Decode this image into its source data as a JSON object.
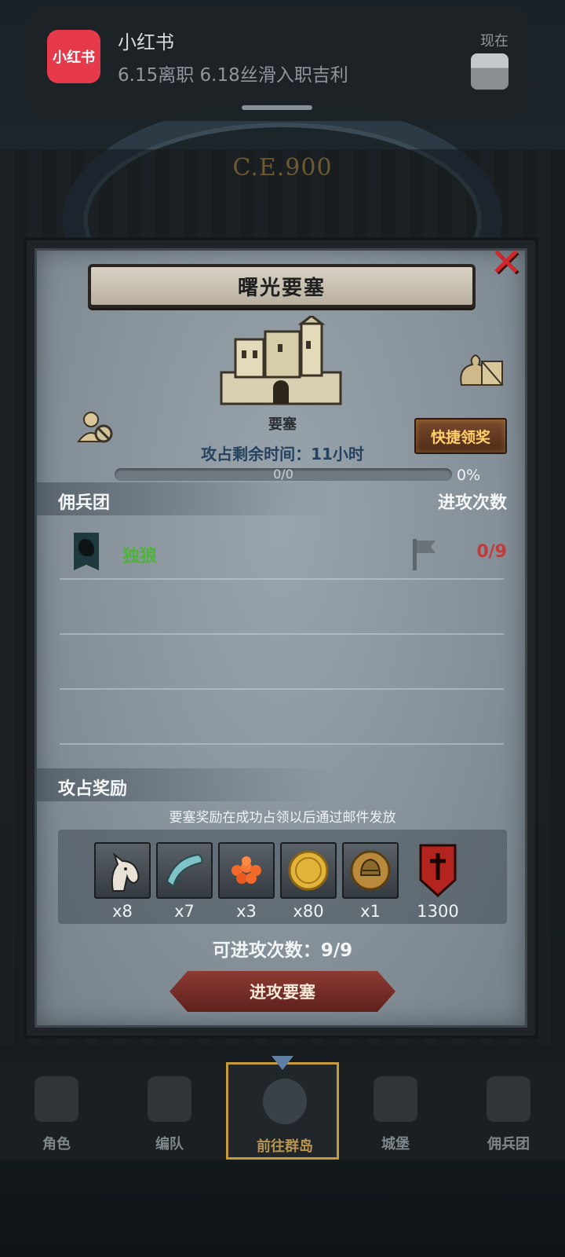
{
  "notification": {
    "app_icon_text": "小红书",
    "app_name": "小红书",
    "message": "6.15离职 6.18丝滑入职吉利",
    "time": "现在"
  },
  "scene": {
    "era": "C.E.900"
  },
  "dialog": {
    "title": "曙光要塞",
    "target_label": "要塞",
    "quick_claim_label": "快捷领奖",
    "remaining_time": "攻占剩余时间：11小时",
    "progress": {
      "text": "0/0",
      "percent_text": "0%",
      "fraction": 0
    },
    "mercenary_section": {
      "title": "佣兵团",
      "right_title": "进攻次数",
      "rows": [
        {
          "name": "独狼",
          "count": "0/9"
        }
      ]
    },
    "reward_section": {
      "title": "攻占奖励",
      "note": "要塞奖励在成功占领以后通过邮件发放",
      "items": [
        {
          "icon": "horse-icon",
          "qty": "x8"
        },
        {
          "icon": "cloth-icon",
          "qty": "x7"
        },
        {
          "icon": "gems-icon",
          "qty": "x3"
        },
        {
          "icon": "gold-coin-icon",
          "qty": "x80"
        },
        {
          "icon": "helmet-medal-icon",
          "qty": "x1"
        },
        {
          "icon": "banner-icon",
          "qty": "1300"
        }
      ]
    },
    "attack_count": "可进攻次数：9/9",
    "attack_button": "进攻要塞"
  },
  "bottom_nav": {
    "items": [
      {
        "label": "角色",
        "icon": "knight-icon"
      },
      {
        "label": "编队",
        "icon": "formation-icon"
      },
      {
        "label": "前往群岛",
        "icon": "globe-icon",
        "active": true
      },
      {
        "label": "城堡",
        "icon": "castle-icon"
      },
      {
        "label": "佣兵团",
        "icon": "mercenary-icon"
      }
    ]
  },
  "colors": {
    "accent_gold": "#c79a3a",
    "merc_name_green": "#4fb23a",
    "count_red": "#c23a3a",
    "close_red": "#d3262a"
  }
}
